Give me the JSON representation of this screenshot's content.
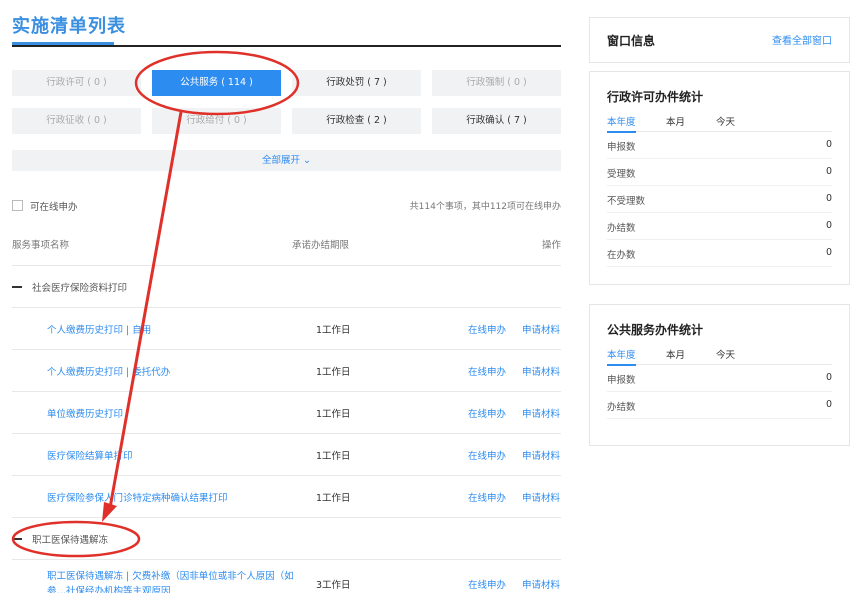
{
  "page_title": "实施清单列表",
  "categories": [
    {
      "label": "行政许可 ( 0 )",
      "state": "disabled"
    },
    {
      "label": "公共服务 ( 114 )",
      "state": "active"
    },
    {
      "label": "行政处罚 ( 7 )",
      "state": "normal"
    },
    {
      "label": "行政强制 ( 0 )",
      "state": "disabled"
    },
    {
      "label": "行政征收 ( 0 )",
      "state": "disabled"
    },
    {
      "label": "行政给付 ( 0 )",
      "state": "disabled"
    },
    {
      "label": "行政检查 ( 2 )",
      "state": "normal"
    },
    {
      "label": "行政确认 ( 7 )",
      "state": "normal"
    }
  ],
  "expand_all": "全部展开 ⌄",
  "online_filter_label": "可在线申办",
  "count_summary": "共114个事项，其中112项可在线申办",
  "table_headers": {
    "name": "服务事项名称",
    "limit": "承诺办结期限",
    "op": "操作"
  },
  "group1": "社会医疗保险资料打印",
  "items": [
    {
      "name": "个人缴费历史打印 | 自用",
      "limit": "1工作日",
      "online": "在线申办",
      "material": "申请材料"
    },
    {
      "name": "个人缴费历史打印 | 委托代办",
      "limit": "1工作日",
      "online": "在线申办",
      "material": "申请材料"
    },
    {
      "name": "单位缴费历史打印",
      "limit": "1工作日",
      "online": "在线申办",
      "material": "申请材料"
    },
    {
      "name": "医疗保险结算单打印",
      "limit": "1工作日",
      "online": "在线申办",
      "material": "申请材料"
    },
    {
      "name": "医疗保险参保人门诊特定病种确认结果打印",
      "limit": "1工作日",
      "online": "在线申办",
      "material": "申请材料"
    }
  ],
  "group2": "职工医保待遇解冻",
  "last_item": {
    "name": "职工医保待遇解冻 | 欠费补缴（因非单位或非个人原因（如参…社保经办机构等主观原因",
    "limit": "3工作日",
    "online": "在线申办",
    "material": "申请材料"
  },
  "window_info": {
    "title": "窗口信息",
    "view_all": "查看全部窗口"
  },
  "permit_stats": {
    "title": "行政许可办件统计",
    "tabs": [
      "本年度",
      "本月",
      "今天"
    ],
    "rows": [
      {
        "label": "申报数",
        "value": "0"
      },
      {
        "label": "受理数",
        "value": "0"
      },
      {
        "label": "不受理数",
        "value": "0"
      },
      {
        "label": "办结数",
        "value": "0"
      },
      {
        "label": "在办数",
        "value": "0"
      }
    ]
  },
  "service_stats": {
    "title": "公共服务办件统计",
    "tabs": [
      "本年度",
      "本月",
      "今天"
    ],
    "rows": [
      {
        "label": "申报数",
        "value": "0"
      },
      {
        "label": "办结数",
        "value": "0"
      }
    ]
  },
  "colors": {
    "accent": "#2d8cf0",
    "annotation": "#e0302a"
  }
}
